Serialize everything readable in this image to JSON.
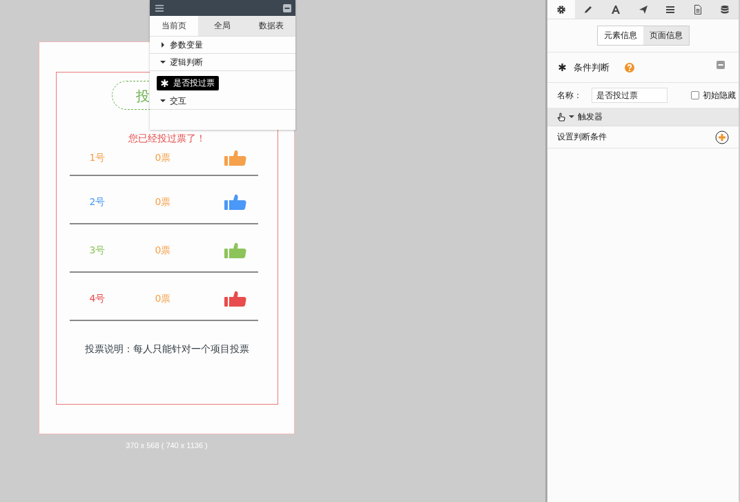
{
  "phone": {
    "vote_button": "投",
    "message": "您已经投过票了！",
    "candidates": [
      {
        "name": "1号",
        "votes": "0票",
        "color": "#f5a04a"
      },
      {
        "name": "2号",
        "votes": "0票",
        "color": "#4a98f7"
      },
      {
        "name": "3号",
        "votes": "0票",
        "color": "#8cc45a"
      },
      {
        "name": "4号",
        "votes": "0票",
        "color": "#e84c4c"
      }
    ],
    "note": "投票说明：每人只能针对一个项目投票",
    "size_label": "370 x 568 ( 740 x 1136 )"
  },
  "logic_panel": {
    "tabs": [
      {
        "label": "当前页",
        "selected": true
      },
      {
        "label": "全局",
        "selected": false
      },
      {
        "label": "数据表",
        "selected": false
      }
    ],
    "sections": [
      {
        "label": "参数变量",
        "expanded": false
      },
      {
        "label": "逻辑判断",
        "expanded": true,
        "items": [
          {
            "label": "是否投过票",
            "selected": true
          }
        ]
      },
      {
        "label": "交互",
        "expanded": true
      }
    ]
  },
  "properties": {
    "tool_tabs": [
      {
        "kind": "gear",
        "selected": true
      },
      {
        "kind": "pencil",
        "selected": false
      },
      {
        "kind": "font",
        "selected": false
      },
      {
        "kind": "send",
        "selected": false
      },
      {
        "kind": "list",
        "selected": false
      },
      {
        "kind": "document",
        "selected": false
      },
      {
        "kind": "database",
        "selected": false
      }
    ],
    "info_tabs": [
      {
        "label": "元素信息",
        "selected": true
      },
      {
        "label": "页面信息",
        "selected": false
      }
    ],
    "title": "条件判断",
    "name_label": "名称：",
    "name_value": "是否投过票",
    "hidden_checkbox": {
      "label": "初始隐藏",
      "checked": false
    },
    "trigger": {
      "label": "触发器",
      "expanded": true
    },
    "condition": "设置判断条件"
  }
}
